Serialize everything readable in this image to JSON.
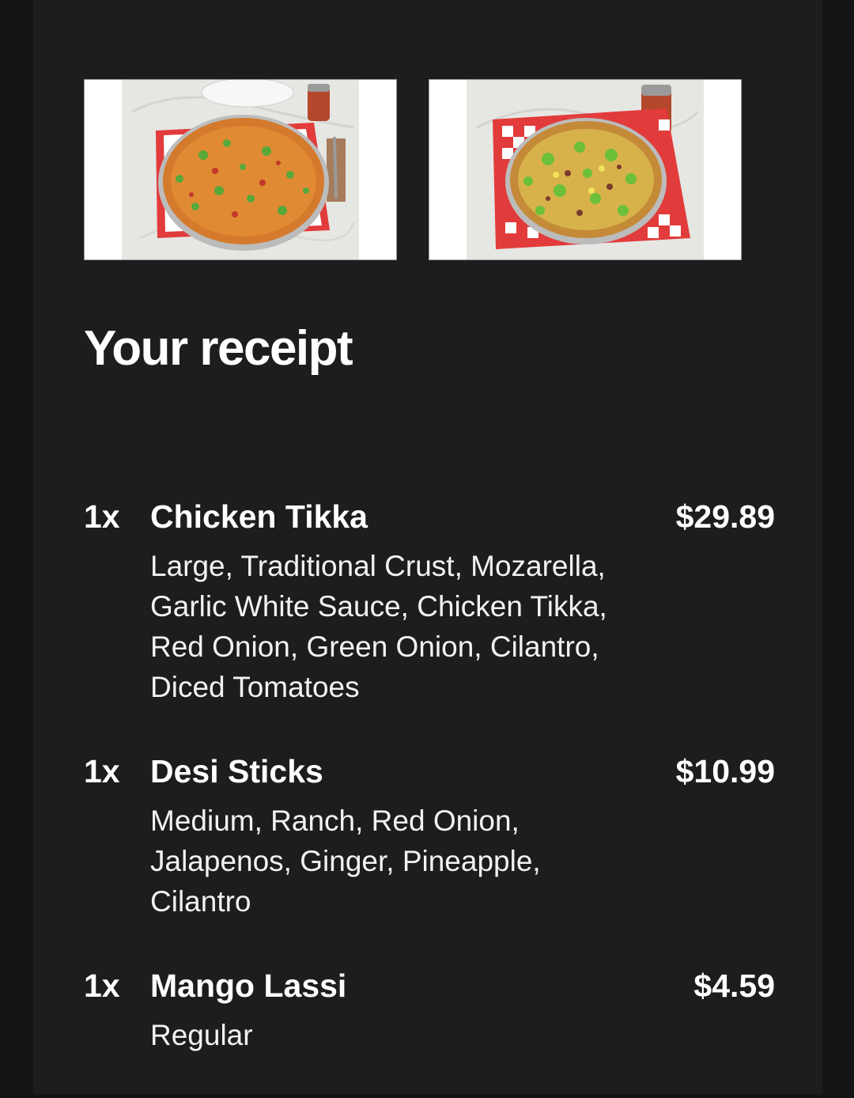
{
  "receipt": {
    "title": "Your receipt",
    "photos": [
      {
        "alt": "chicken-tikka-pizza-photo"
      },
      {
        "alt": "desi-sticks-pizza-photo"
      }
    ],
    "items": [
      {
        "qty": "1x",
        "name": "Chicken Tikka",
        "price": "$29.89",
        "details": "Large, Traditional Crust, Mozarella, Garlic White Sauce, Chicken Tikka, Red Onion, Green Onion, Cilantro, Diced Tomatoes"
      },
      {
        "qty": "1x",
        "name": "Desi Sticks",
        "price": "$10.99",
        "details": "Medium, Ranch, Red Onion, Jalapenos, Ginger, Pineapple, Cilantro"
      },
      {
        "qty": "1x",
        "name": "Mango Lassi",
        "price": "$4.59",
        "details": "Regular"
      }
    ]
  }
}
